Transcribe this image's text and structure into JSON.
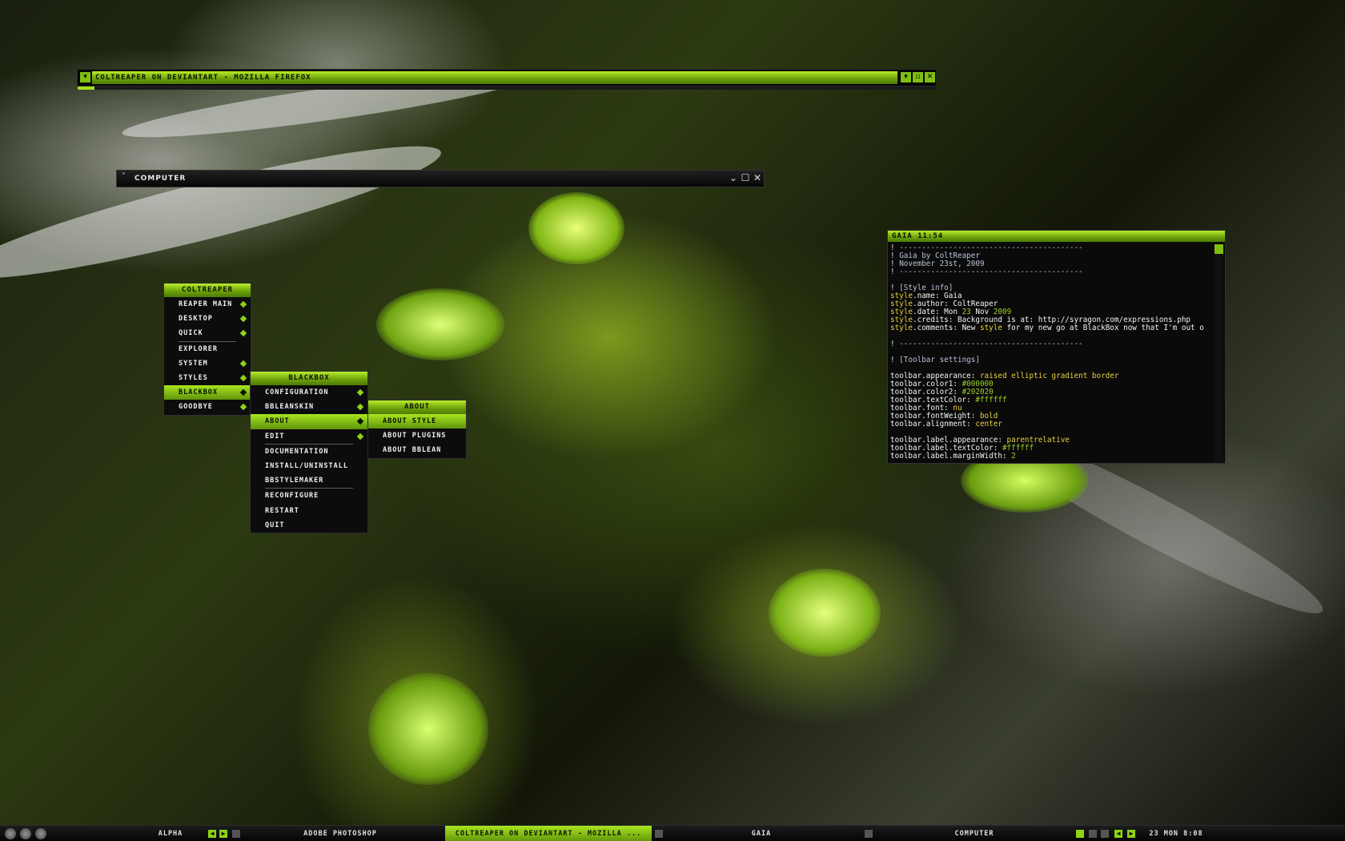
{
  "firefox_window": {
    "title": "COLTREAPER ON DEVIANTART - MOZILLA FIREFOX",
    "progress_fraction": 0.02,
    "buttons": {
      "menu": "▾",
      "minimize": "▾",
      "maximize": "▫",
      "close": "✕"
    }
  },
  "computer_window": {
    "title": "COMPUTER",
    "chevron": "˅",
    "buttons": {
      "minimize": "⌄",
      "maximize": "☐",
      "close": "✕"
    }
  },
  "menus": {
    "root": {
      "title": "COLTREAPER",
      "items": [
        {
          "label": "REAPER MAIN",
          "submenu": true
        },
        {
          "label": "DESKTOP",
          "submenu": true
        },
        {
          "label": "QUICK",
          "submenu": true
        },
        {
          "label": "EXPLORER",
          "submenu": false,
          "separator_before": true
        },
        {
          "label": "SYSTEM",
          "submenu": true
        },
        {
          "label": "STYLES",
          "submenu": true
        },
        {
          "label": "BLACKBOX",
          "submenu": true,
          "active": true
        },
        {
          "label": "GOODBYE",
          "submenu": true
        }
      ]
    },
    "blackbox": {
      "title": "BLACKBOX",
      "items": [
        {
          "label": "CONFIGURATION",
          "submenu": true
        },
        {
          "label": "BBLEANSKIN",
          "submenu": true
        },
        {
          "label": "ABOUT",
          "submenu": true,
          "active": true
        },
        {
          "label": "EDIT",
          "submenu": true
        },
        {
          "label": "DOCUMENTATION",
          "submenu": false,
          "separator_before": true
        },
        {
          "label": "INSTALL/UNINSTALL",
          "submenu": false
        },
        {
          "label": "BBSTYLEMAKER",
          "submenu": false
        },
        {
          "label": "RECONFIGURE",
          "submenu": false,
          "separator_before": true
        },
        {
          "label": "RESTART",
          "submenu": false
        },
        {
          "label": "QUIT",
          "submenu": false
        }
      ]
    },
    "about": {
      "title": "ABOUT",
      "items": [
        {
          "label": "ABOUT STYLE",
          "submenu": false,
          "active": true
        },
        {
          "label": "ABOUT PLUGINS",
          "submenu": false
        },
        {
          "label": "ABOUT BBLEAN",
          "submenu": false
        }
      ]
    }
  },
  "gaia_window": {
    "title": "GAIA 11:54",
    "lines": [
      [
        [
          "c-bang",
          "! "
        ],
        [
          "c-comment",
          "-----------------------------------------"
        ]
      ],
      [
        [
          "c-bang",
          "! "
        ],
        [
          "c-comment",
          "Gaia by ColtReaper"
        ]
      ],
      [
        [
          "c-bang",
          "! "
        ],
        [
          "c-comment",
          "November 23st, 2009"
        ]
      ],
      [
        [
          "c-bang",
          "! "
        ],
        [
          "c-comment",
          "-----------------------------------------"
        ]
      ],
      [],
      [
        [
          "c-bang",
          "! "
        ],
        [
          "c-comment",
          "[Style info]"
        ]
      ],
      [
        [
          "c-kw",
          "style"
        ],
        [
          "c-key",
          ".name: Gaia"
        ]
      ],
      [
        [
          "c-kw",
          "style"
        ],
        [
          "c-key",
          ".author: ColtReaper"
        ]
      ],
      [
        [
          "c-kw",
          "style"
        ],
        [
          "c-key",
          ".date: Mon "
        ],
        [
          "c-num",
          "23"
        ],
        [
          "c-key",
          " Nov "
        ],
        [
          "c-num",
          "2009"
        ]
      ],
      [
        [
          "c-kw",
          "style"
        ],
        [
          "c-key",
          ".credits: Background is at: http://syragon.com/expressions.php"
        ]
      ],
      [
        [
          "c-kw",
          "style"
        ],
        [
          "c-key",
          ".comments: New "
        ],
        [
          "c-kw",
          "style"
        ],
        [
          "c-key",
          " for my new go at BlackBox now that I'm out o"
        ]
      ],
      [],
      [
        [
          "c-bang",
          "! "
        ],
        [
          "c-comment",
          "-----------------------------------------"
        ]
      ],
      [],
      [
        [
          "c-bang",
          "! "
        ],
        [
          "c-comment",
          "[Toolbar settings]"
        ]
      ],
      [],
      [
        [
          "c-key",
          "toolbar.appearance: "
        ],
        [
          "c-str",
          "raised elliptic gradient border"
        ]
      ],
      [
        [
          "c-key",
          "toolbar.color1: "
        ],
        [
          "c-num",
          "#000000"
        ]
      ],
      [
        [
          "c-key",
          "toolbar.color2: "
        ],
        [
          "c-num",
          "#202020"
        ]
      ],
      [
        [
          "c-key",
          "toolbar.textColor: "
        ],
        [
          "c-num",
          "#ffffff"
        ]
      ],
      [
        [
          "c-key",
          "toolbar.font: "
        ],
        [
          "c-str",
          "nu"
        ]
      ],
      [
        [
          "c-key",
          "toolbar.fontWeight: "
        ],
        [
          "c-str",
          "bold"
        ]
      ],
      [
        [
          "c-key",
          "toolbar.alignment: "
        ],
        [
          "c-str",
          "center"
        ]
      ],
      [],
      [
        [
          "c-key",
          "toolbar.label.appearance: "
        ],
        [
          "c-str",
          "parentrelative"
        ]
      ],
      [
        [
          "c-key",
          "toolbar.label.textColor: "
        ],
        [
          "c-num",
          "#ffffff"
        ]
      ],
      [
        [
          "c-key",
          "toolbar.label.marginWidth: "
        ],
        [
          "c-num",
          "2"
        ]
      ]
    ]
  },
  "taskbar": {
    "workspace": "ALPHA",
    "tasks": [
      {
        "label": "ADOBE PHOTOSHOP",
        "active": false
      },
      {
        "label": "COLTREAPER ON DEVIANTART - MOZILLA ...",
        "active": true
      },
      {
        "label": "GAIA",
        "active": false
      },
      {
        "label": "COMPUTER",
        "active": false
      }
    ],
    "clock": "23 MON 8:08",
    "nav_prev": "◀",
    "nav_next": "▶"
  },
  "colors": {
    "accent": "#8fd314",
    "accent_dark": "#5f950a",
    "background": "#0c0c0c"
  }
}
